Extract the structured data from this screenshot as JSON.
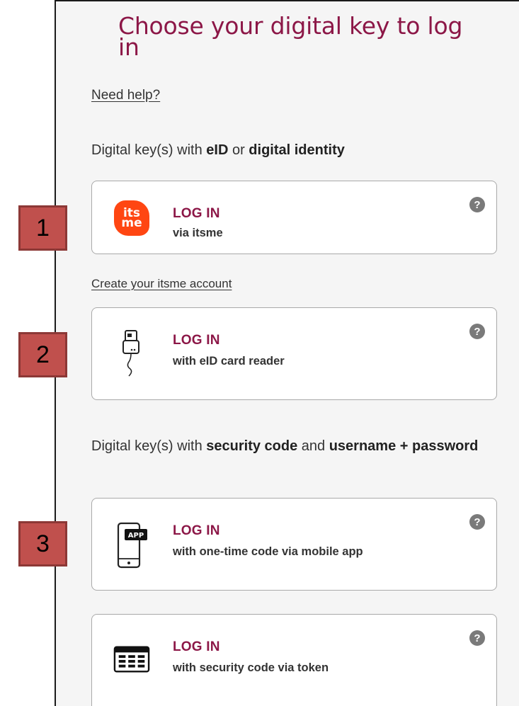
{
  "header": {
    "title": "Choose your digital key to log in"
  },
  "help_link": "Need help?",
  "section1": {
    "pre": "Digital key(s) with ",
    "b1": "eID",
    "mid": " or ",
    "b2": "digital identity"
  },
  "section2": {
    "pre": "Digital key(s) with ",
    "b1": "security code",
    "mid": " and ",
    "b2": "username + password"
  },
  "create_link": "Create your itsme account",
  "help_glyph": "?",
  "options": [
    {
      "title": "LOG IN",
      "subtitle": "via itsme",
      "icon": "itsme-logo",
      "logo_top": "its",
      "logo_bottom": "me"
    },
    {
      "title": "LOG IN",
      "subtitle": "with eID card reader",
      "icon": "card-reader-icon"
    },
    {
      "title": "LOG IN",
      "subtitle": "with one-time code via mobile app",
      "icon": "mobile-app-icon",
      "badge": "APP"
    },
    {
      "title": "LOG IN",
      "subtitle": "with security code via token",
      "icon": "token-icon"
    }
  ],
  "markers": [
    "1",
    "2",
    "3"
  ],
  "colors": {
    "brand": "#8c1747",
    "itsme": "#ff4612",
    "marker": "#c0504d"
  }
}
